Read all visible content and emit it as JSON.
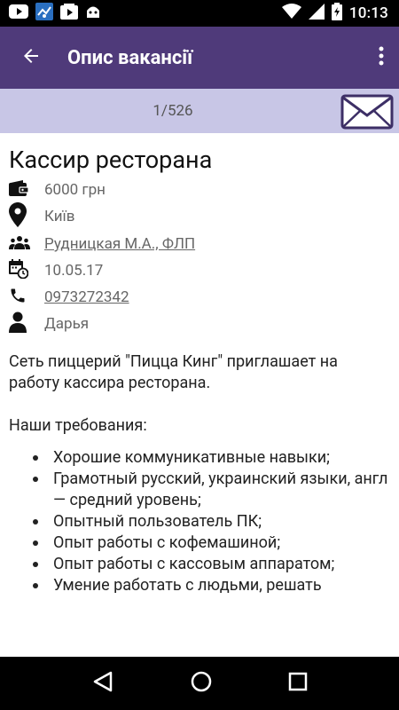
{
  "status_bar": {
    "time": "10:13",
    "icons": [
      "youtube-icon",
      "app-icon",
      "media-icon",
      "android-icon",
      "wifi-icon",
      "signal-icon",
      "battery-icon"
    ]
  },
  "app_bar": {
    "title": "Опис вакансії",
    "color": "#4f3a7a"
  },
  "counter": {
    "text": "1/526"
  },
  "job": {
    "title": "Кассир ресторана",
    "salary": "6000 грн",
    "city": "Київ",
    "employer": "Рудницкая М.А., ФЛП",
    "date": "10.05.17",
    "phone": "0973272342",
    "contact": "Дарья"
  },
  "description": {
    "intro": "Сеть пиццерий \"Пицца Кинг\" приглашает на работу кассира ресторана.",
    "req_header": "Наши требования:",
    "requirements": [
      "Хорошие коммуникативные навыки;",
      "Грамотный русский, украинский языки, англ — средний уровень;",
      "Опытный пользователь ПК;",
      "Опыт работы с кофемашиной;",
      "Опыт работы с кассовым аппаратом;",
      "Умение работать с людьми, решать"
    ]
  }
}
